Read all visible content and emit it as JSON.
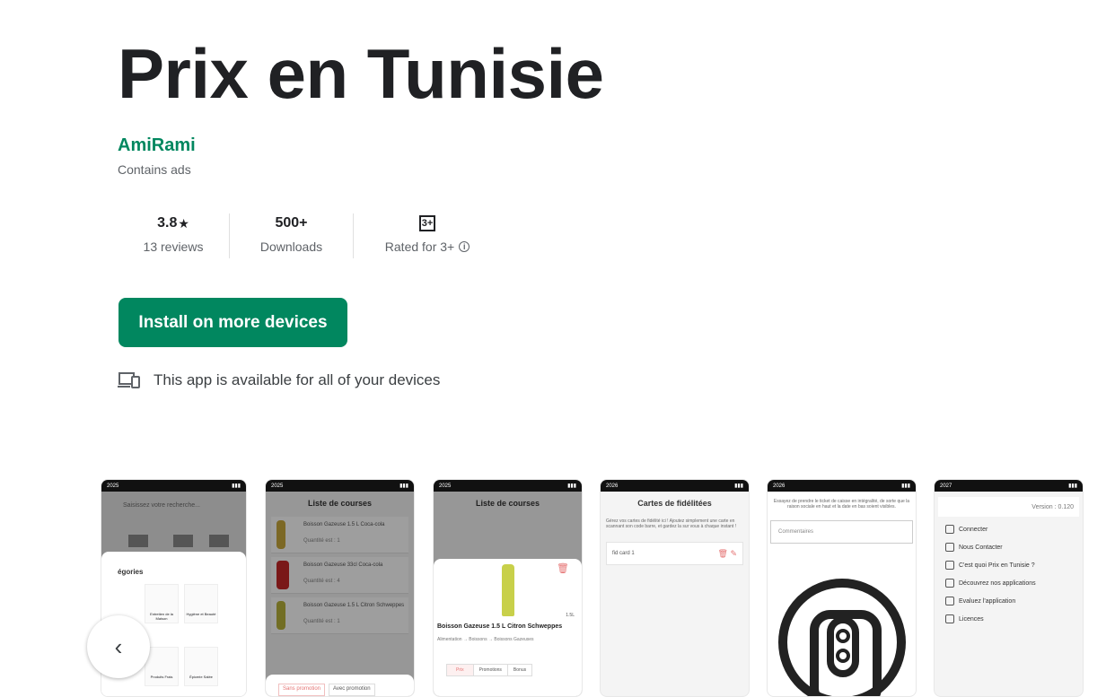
{
  "app": {
    "title": "Prix en Tunisie",
    "developer": "AmiRami",
    "ads_note": "Contains ads"
  },
  "stats": {
    "rating": "3.8",
    "rating_star": "★",
    "reviews": "13 reviews",
    "downloads": "500+",
    "downloads_label": "Downloads",
    "content_rating_badge": "3+",
    "content_rating_label": "Rated for 3+"
  },
  "install_button": "Install on more devices",
  "availability": "This app is available for all of your devices",
  "colors": {
    "brand_green": "#01875f"
  },
  "screenshots": [
    {
      "status": "2025",
      "search_placeholder": "Saisissez votre recherche...",
      "section": "égories",
      "tiles": [
        "Entretien de la Maison",
        "Hygiène et Beauté",
        "Produits Frais",
        "Épicerie Salée"
      ]
    },
    {
      "status": "2025",
      "title": "Liste de courses",
      "items": [
        {
          "name": "Boisson Gazeuse 1.5 L Coca-cola",
          "qty": "Quantité est : 1"
        },
        {
          "name": "Boisson Gazeuse 33cl Coca-cola",
          "qty": "Quantité est : 4"
        },
        {
          "name": "Boisson Gazeuse 1.5 L Citron Schweppes",
          "qty": "Quantité est : 1"
        }
      ],
      "tabs": [
        "Sans promotion",
        "Avec promotion"
      ]
    },
    {
      "status": "2025",
      "title": "Liste de courses",
      "product": "Boisson Gazeuse 1.5 L Citron Schweppes",
      "size": "1.5L",
      "path": "Alimentation → Boissons → Boissons Gazeuses",
      "tabs": [
        "Prix",
        "Promotions",
        "Bonus"
      ]
    },
    {
      "status": "2026",
      "title": "Cartes de fidélitées",
      "description": "Gérez vos cartes de fidélité ici ! Ajoutez simplement une carte en scannant son code barre, et gardez la sur vous à chaque instant !",
      "card": "fid card 1"
    },
    {
      "status": "2026",
      "hint": "Essayez de prendre le ticket de caisse en intégralité, de sorte que la raison sociale en haut et la date en bas soient visibles.",
      "comment_placeholder": "Commentaires"
    },
    {
      "status": "2027",
      "version": "Version : 0.120",
      "menu": [
        "Connecter",
        "Nous Contacter",
        "C'est quoi Prix en Tunisie ?",
        "Découvrez nos applications",
        "Evaluez l'application",
        "Licences"
      ]
    }
  ],
  "icons": {
    "devices": "devices-icon",
    "info": "info-icon",
    "prev": "chevron-left-icon"
  }
}
